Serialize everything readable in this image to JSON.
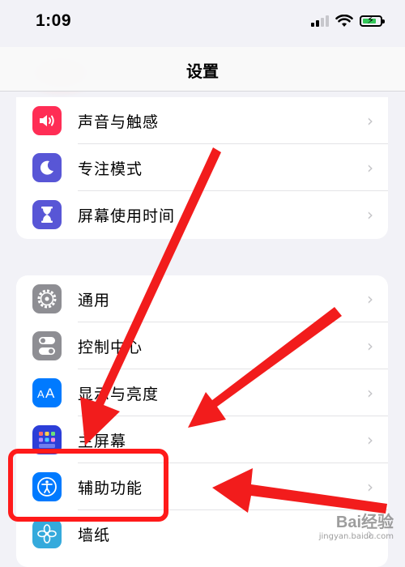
{
  "status_bar": {
    "time": "1:09"
  },
  "nav": {
    "title": "设置"
  },
  "groups": [
    {
      "items": [
        {
          "label": "声音与触感",
          "icon": "speaker-icon",
          "color": "#ff2d55"
        },
        {
          "label": "专注模式",
          "icon": "moon-icon",
          "color": "#5856d6"
        },
        {
          "label": "屏幕使用时间",
          "icon": "hourglass-icon",
          "color": "#5856d6"
        }
      ]
    },
    {
      "items": [
        {
          "label": "通用",
          "icon": "gear-icon",
          "color": "#8e8e93"
        },
        {
          "label": "控制中心",
          "icon": "toggles-icon",
          "color": "#8e8e93"
        },
        {
          "label": "显示与亮度",
          "icon": "text-size-icon",
          "color": "#007aff"
        },
        {
          "label": "主屏幕",
          "icon": "home-grid-icon",
          "color": "#2c3ed8"
        },
        {
          "label": "辅助功能",
          "icon": "accessibility-icon",
          "color": "#007aff"
        },
        {
          "label": "墙纸",
          "icon": "flower-icon",
          "color": "#35aadc"
        }
      ]
    }
  ],
  "annotation": {
    "highlight_color": "#ff1a1a"
  },
  "watermark": {
    "main": "Bai经验",
    "sub": "jingyan.baidu.com"
  }
}
